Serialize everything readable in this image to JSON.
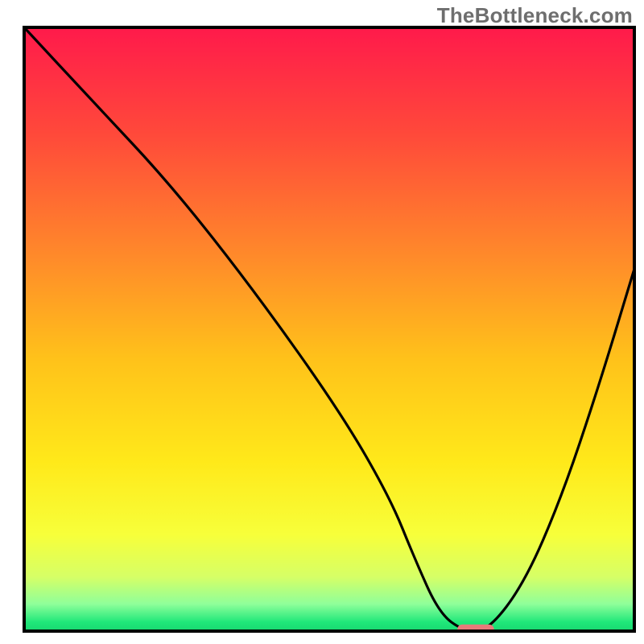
{
  "watermark": "TheBottleneck.com",
  "chart_data": {
    "type": "line",
    "title": "",
    "xlabel": "",
    "ylabel": "",
    "xlim": [
      0,
      100
    ],
    "ylim": [
      0,
      100
    ],
    "legend": false,
    "grid": false,
    "background_gradient_stops": [
      {
        "offset": 0.0,
        "color": "#ff1a4b"
      },
      {
        "offset": 0.18,
        "color": "#ff4a3a"
      },
      {
        "offset": 0.38,
        "color": "#ff8a2a"
      },
      {
        "offset": 0.55,
        "color": "#ffc21a"
      },
      {
        "offset": 0.72,
        "color": "#ffe91a"
      },
      {
        "offset": 0.84,
        "color": "#f7ff3a"
      },
      {
        "offset": 0.91,
        "color": "#d6ff66"
      },
      {
        "offset": 0.955,
        "color": "#8fff9a"
      },
      {
        "offset": 0.985,
        "color": "#20e87a"
      },
      {
        "offset": 1.0,
        "color": "#18d870"
      }
    ],
    "series": [
      {
        "name": "bottleneck-curve",
        "color": "#000000",
        "x": [
          0,
          11,
          24,
          38,
          52,
          60,
          64,
          68,
          72,
          76,
          82,
          88,
          94,
          100
        ],
        "values": [
          100,
          88,
          74,
          56,
          36,
          22,
          12,
          3,
          0,
          0,
          8,
          22,
          40,
          60
        ]
      }
    ],
    "marker": {
      "name": "optimal-point",
      "x": 74,
      "y": 0,
      "color": "#e77a7a",
      "width": 6,
      "height": 2
    },
    "frame_color": "#000000",
    "frame_width": 4
  }
}
